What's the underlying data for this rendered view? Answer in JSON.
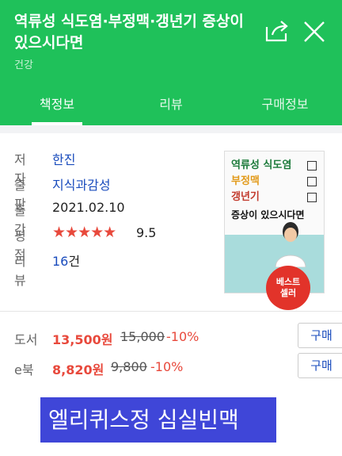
{
  "header": {
    "title": "역류성 식도염·부정맥·갱년기 증상이 있으시다면",
    "category": "건강"
  },
  "tabs": [
    {
      "label": "책정보",
      "active": true
    },
    {
      "label": "리뷰",
      "active": false
    },
    {
      "label": "구매정보",
      "active": false
    }
  ],
  "info": {
    "author_label": "저자",
    "author": "한진",
    "publisher_label": "출판",
    "publisher": "지식과감성",
    "date_label": "출간",
    "date": "2021.02.10",
    "rating_label": "평점",
    "stars": "★★★★★",
    "rating": "9.5",
    "review_label": "리뷰",
    "review_count": "16",
    "review_unit": "건"
  },
  "cover": {
    "line1": "역류성 식도염",
    "line2": "부정맥",
    "line3": "갱년기",
    "line4": "증상이 있으시다면",
    "badge_line1": "베스트",
    "badge_line2": "셀러"
  },
  "prices": [
    {
      "label": "도서",
      "price": "13,500원",
      "original": "15,000",
      "discount": "-10%",
      "button": "구매"
    },
    {
      "label": "e북",
      "price": "8,820원",
      "original": "9,800",
      "discount": "-10%",
      "button": "구매"
    }
  ],
  "overlay_text": "엘리퀴스정 심실빈맥",
  "colors": {
    "brand_green": "#1fc15a",
    "accent_red": "#e8493c",
    "link_blue": "#1a4cbd",
    "overlay_blue": "#3f46d8"
  },
  "icons": [
    "share-icon",
    "close-icon",
    "star-icon"
  ]
}
